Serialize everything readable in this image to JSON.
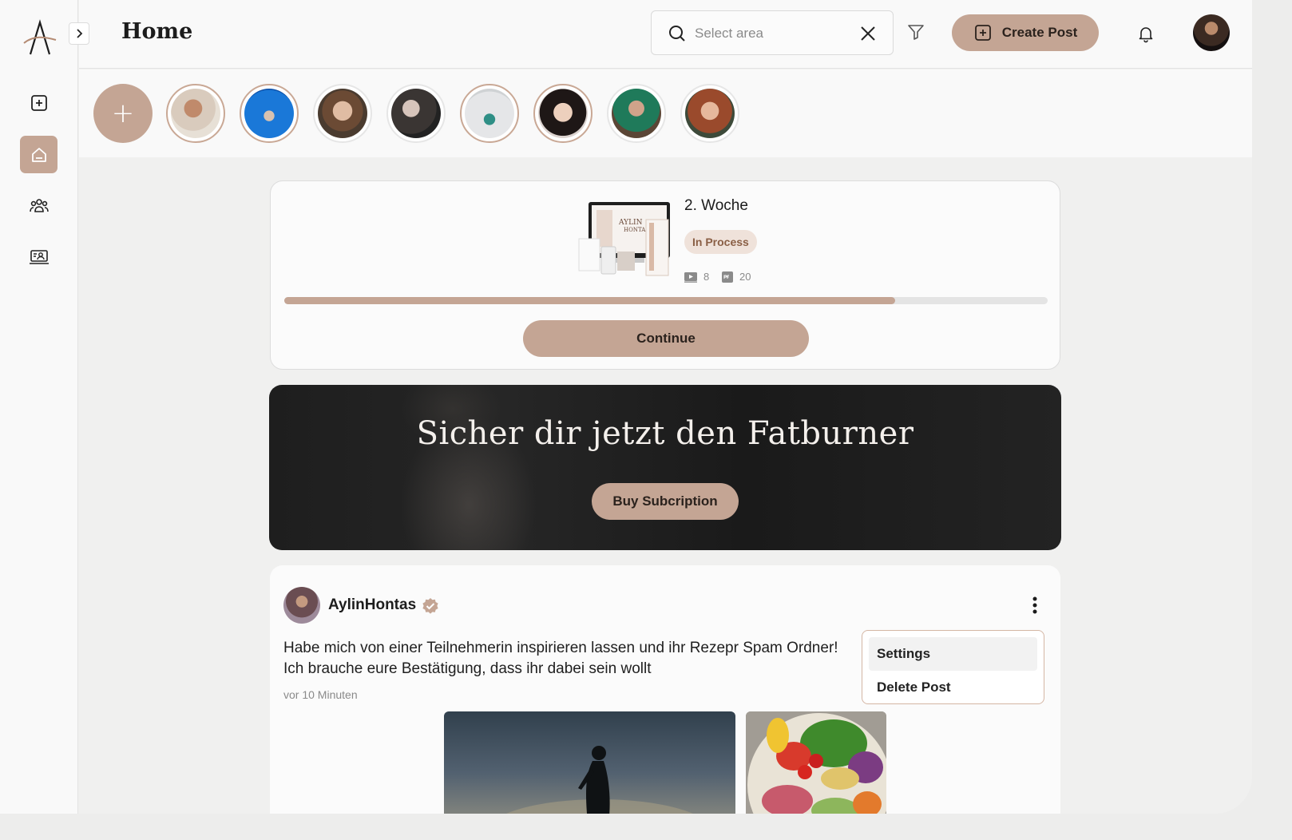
{
  "header": {
    "title": "Home",
    "search_placeholder": "Select area",
    "create_post_label": "Create Post"
  },
  "sidebar": {
    "items": [
      {
        "icon": "add-square-icon"
      },
      {
        "icon": "home-icon",
        "active": true
      },
      {
        "icon": "community-icon"
      },
      {
        "icon": "courses-icon"
      }
    ]
  },
  "stories": {
    "add_label": "+",
    "count": 8
  },
  "course": {
    "title": "2. Woche",
    "status": "In Process",
    "video_count": "8",
    "pdf_count": "20",
    "progress_percent": 80,
    "continue_label": "Continue"
  },
  "banner": {
    "title": "Sicher dir jetzt den Fatburner",
    "button_label": "Buy Subcription"
  },
  "post": {
    "author": "AylinHontas",
    "text": "Habe mich von einer Teilnehmerin inspirieren lassen und ihr Rezepr Spam Ordner! Ich brauche eure Bestätigung, dass ihr dabei sein wollt",
    "time": "vor 10 Minuten"
  },
  "post_menu": {
    "settings_label": "Settings",
    "delete_label": "Delete Post"
  },
  "colors": {
    "accent": "#c4a594",
    "badge_bg": "#efe2da",
    "badge_text": "#8a5f45"
  }
}
